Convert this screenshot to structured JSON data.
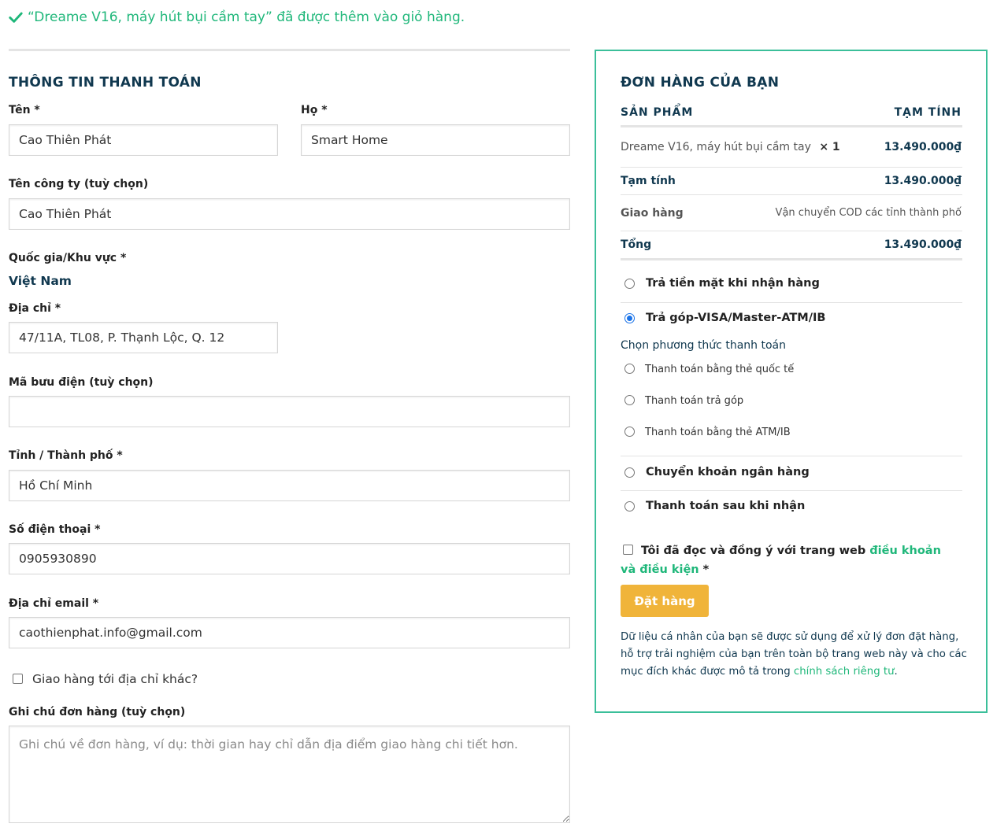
{
  "notice": {
    "text": "“Dreame V16, máy hút bụi cầm tay” đã được thêm vào giỏ hàng.",
    "icon": "check-icon",
    "color": "#1fb77a"
  },
  "billing": {
    "title": "THÔNG TIN THANH TOÁN",
    "first_name": {
      "label": "Tên *",
      "value": "Cao Thiên Phát"
    },
    "last_name": {
      "label": "Họ *",
      "value": "Smart Home"
    },
    "company": {
      "label": "Tên công ty (tuỳ chọn)",
      "value": "Cao Thiên Phát"
    },
    "country": {
      "label": "Quốc gia/Khu vực *",
      "value": "Việt Nam"
    },
    "address": {
      "label": "Địa chỉ *",
      "value": "47/11A, TL08, P. Thạnh Lộc, Q. 12"
    },
    "postcode": {
      "label": "Mã bưu điện (tuỳ chọn)",
      "value": ""
    },
    "city": {
      "label": "Tỉnh / Thành phố *",
      "value": "Hồ Chí Minh"
    },
    "phone": {
      "label": "Số điện thoại *",
      "value": "0905930890"
    },
    "email": {
      "label": "Địa chỉ email *",
      "value": "caothienphat.info@gmail.com"
    },
    "ship_different": {
      "label": "Giao hàng tới địa chỉ khác?",
      "checked": false
    },
    "notes": {
      "label": "Ghi chú đơn hàng (tuỳ chọn)",
      "placeholder": "Ghi chú về đơn hàng, ví dụ: thời gian hay chỉ dẫn địa điểm giao hàng chi tiết hơn.",
      "value": ""
    }
  },
  "order": {
    "title": "ĐƠN HÀNG CỦA BẠN",
    "col_product": "SẢN PHẨM",
    "col_subtotal": "TẠM TÍNH",
    "item": {
      "name": "Dreame V16, máy hút bụi cầm tay",
      "qty": "× 1",
      "price": "13.490.000₫"
    },
    "subtotal": {
      "label": "Tạm tính",
      "value": "13.490.000₫"
    },
    "shipping": {
      "label": "Giao hàng",
      "value": "Vận chuyển COD các tỉnh thành phố"
    },
    "total": {
      "label": "Tổng",
      "value": "13.490.000₫"
    },
    "payment_methods": [
      {
        "label": "Trả tiền mặt khi nhận hàng",
        "selected": false
      },
      {
        "label": "Trả góp-VISA/Master-ATM/IB",
        "selected": true
      },
      {
        "label": "Chuyển khoản ngân hàng",
        "selected": false
      },
      {
        "label": "Thanh toán sau khi nhận",
        "selected": false
      }
    ],
    "sub_heading": "Chọn phương thức thanh toán",
    "sub_options": [
      {
        "label": "Thanh toán bằng thẻ quốc tế",
        "selected": false
      },
      {
        "label": "Thanh toán trả góp",
        "selected": false
      },
      {
        "label": "Thanh toán bằng thẻ ATM/IB",
        "selected": false
      }
    ],
    "terms": {
      "prefix": "Tôi đã đọc và đồng ý với trang web ",
      "link": "điều khoản và điều kiện",
      "suffix": " *",
      "checked": false
    },
    "place_order": "Đặt hàng",
    "privacy": {
      "text": "Dữ liệu cá nhân của bạn sẽ được sử dụng để xử lý đơn đặt hàng, hỗ trợ trải nghiệm của bạn trên toàn bộ trang web này và cho các mục đích khác được mô tả trong ",
      "link": "chính sách riêng tư",
      "end": "."
    },
    "accent_color": "#3bbf9a",
    "button_color": "#f0b43a"
  }
}
